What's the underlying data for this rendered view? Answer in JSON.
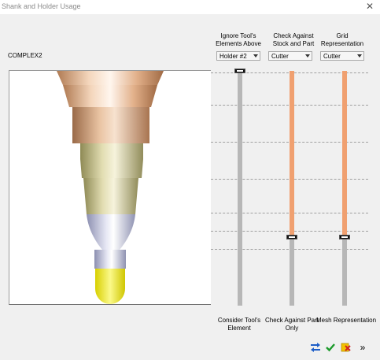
{
  "window": {
    "title": "Shank and Holder Usage",
    "close_glyph": "✕"
  },
  "tool_name": "COMPLEX2",
  "columns": [
    {
      "header": "Ignore Tool's Elements Above",
      "selected": "Holder #2",
      "bottom_label": "Consider Tool's Element",
      "level": 1.0,
      "fill_color": "#2f6fe0"
    },
    {
      "header": "Check Against Stock and Part",
      "selected": "Cutter",
      "bottom_label": "Check Against Part Only",
      "level": 0.24,
      "fill_color": "#f0a070"
    },
    {
      "header": "Grid Representation",
      "selected": "Cutter",
      "bottom_label": "Mesh Representation",
      "level": 0.24,
      "fill_color": "#f0a070"
    }
  ],
  "colors": {
    "inactive_track": "#b7b7b7",
    "accent_blue": "#2f6fe0",
    "accent_orange": "#f0a070",
    "ok_green": "#1b9a2a"
  },
  "buttons": [
    {
      "name": "swap-icon-button",
      "icon": "swap-arrows-icon"
    },
    {
      "name": "ok-button",
      "icon": "checkmark-icon"
    },
    {
      "name": "cancel-button",
      "icon": "cancel-x-icon"
    },
    {
      "name": "more-button",
      "icon": "double-chevron-right-icon",
      "label": "»"
    }
  ]
}
